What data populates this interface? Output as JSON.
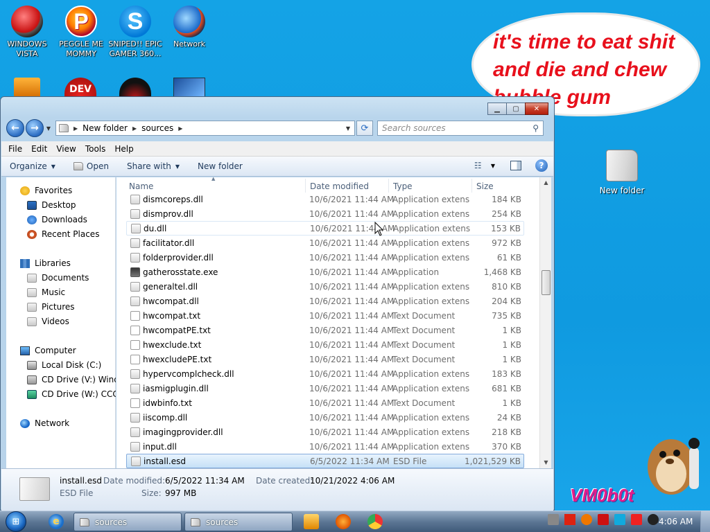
{
  "desktop": {
    "icons": [
      {
        "label_line1": "WINDOWS",
        "label_line2": "VISTA"
      },
      {
        "label_line1": "PEGGLE ME",
        "label_line2": "MOMMY"
      },
      {
        "label_line1": "SNIPED!! EPIC",
        "label_line2": "GAMER 360..."
      },
      {
        "label_line1": "Network",
        "label_line2": ""
      }
    ],
    "dev_badge": "DEV",
    "bubble_text": "it's time to eat shit and die and chew bubble gum",
    "new_folder_label": "New folder",
    "watermark": "VM0b0t"
  },
  "window": {
    "address": {
      "crumbs": [
        "New folder",
        "sources"
      ],
      "search_placeholder": "Search sources"
    },
    "menu": [
      "File",
      "Edit",
      "View",
      "Tools",
      "Help"
    ],
    "toolbar": {
      "organize": "Organize",
      "open": "Open",
      "share_with": "Share with",
      "new_folder": "New folder"
    },
    "nav": {
      "favorites": "Favorites",
      "desktop": "Desktop",
      "downloads": "Downloads",
      "recent": "Recent Places",
      "libraries": "Libraries",
      "documents": "Documents",
      "music": "Music",
      "pictures": "Pictures",
      "videos": "Videos",
      "computer": "Computer",
      "local_disk": "Local Disk (C:)",
      "cd_v": "CD Drive (V:) Windo",
      "cd_w": "CD Drive (W:) CCCO",
      "network": "Network"
    },
    "columns": {
      "name": "Name",
      "date": "Date modified",
      "type": "Type",
      "size": "Size"
    },
    "files": [
      {
        "name": "dismcoreps.dll",
        "date": "10/6/2021 11:44 AM",
        "type": "Application extens...",
        "size": "184 KB",
        "icon": "dll"
      },
      {
        "name": "dismprov.dll",
        "date": "10/6/2021 11:44 AM",
        "type": "Application extens...",
        "size": "254 KB",
        "icon": "dll"
      },
      {
        "name": "du.dll",
        "date": "10/6/2021 11:44 AM",
        "type": "Application extens...",
        "size": "153 KB",
        "icon": "dll"
      },
      {
        "name": "facilitator.dll",
        "date": "10/6/2021 11:44 AM",
        "type": "Application extens...",
        "size": "972 KB",
        "icon": "dll"
      },
      {
        "name": "folderprovider.dll",
        "date": "10/6/2021 11:44 AM",
        "type": "Application extens...",
        "size": "61 KB",
        "icon": "dll"
      },
      {
        "name": "gatherosstate.exe",
        "date": "10/6/2021 11:44 AM",
        "type": "Application",
        "size": "1,468 KB",
        "icon": "exe"
      },
      {
        "name": "generaltel.dll",
        "date": "10/6/2021 11:44 AM",
        "type": "Application extens...",
        "size": "810 KB",
        "icon": "dll"
      },
      {
        "name": "hwcompat.dll",
        "date": "10/6/2021 11:44 AM",
        "type": "Application extens...",
        "size": "204 KB",
        "icon": "dll"
      },
      {
        "name": "hwcompat.txt",
        "date": "10/6/2021 11:44 AM",
        "type": "Text Document",
        "size": "735 KB",
        "icon": "txt"
      },
      {
        "name": "hwcompatPE.txt",
        "date": "10/6/2021 11:44 AM",
        "type": "Text Document",
        "size": "1 KB",
        "icon": "txt"
      },
      {
        "name": "hwexclude.txt",
        "date": "10/6/2021 11:44 AM",
        "type": "Text Document",
        "size": "1 KB",
        "icon": "txt"
      },
      {
        "name": "hwexcludePE.txt",
        "date": "10/6/2021 11:44 AM",
        "type": "Text Document",
        "size": "1 KB",
        "icon": "txt"
      },
      {
        "name": "hypervcomplcheck.dll",
        "date": "10/6/2021 11:44 AM",
        "type": "Application extens...",
        "size": "183 KB",
        "icon": "dll"
      },
      {
        "name": "iasmigplugin.dll",
        "date": "10/6/2021 11:44 AM",
        "type": "Application extens...",
        "size": "681 KB",
        "icon": "dll"
      },
      {
        "name": "idwbinfo.txt",
        "date": "10/6/2021 11:44 AM",
        "type": "Text Document",
        "size": "1 KB",
        "icon": "txt"
      },
      {
        "name": "iiscomp.dll",
        "date": "10/6/2021 11:44 AM",
        "type": "Application extens...",
        "size": "24 KB",
        "icon": "dll"
      },
      {
        "name": "imagingprovider.dll",
        "date": "10/6/2021 11:44 AM",
        "type": "Application extens...",
        "size": "218 KB",
        "icon": "dll"
      },
      {
        "name": "input.dll",
        "date": "10/6/2021 11:44 AM",
        "type": "Application extens...",
        "size": "370 KB",
        "icon": "dll"
      },
      {
        "name": "install.esd",
        "date": "6/5/2022 11:34 AM",
        "type": "ESD File",
        "size": "1,021,529 KB",
        "icon": "esd",
        "selected": true
      }
    ],
    "details": {
      "name": "install.esd",
      "type": "ESD File",
      "date_modified_label": "Date modified:",
      "date_modified": "6/5/2022 11:34 AM",
      "date_created_label": "Date created:",
      "date_created": "10/21/2022 4:06 AM",
      "size_label": "Size:",
      "size": "997 MB"
    }
  },
  "taskbar": {
    "tasks": [
      "sources",
      "sources"
    ],
    "clock": "4:06 AM"
  }
}
